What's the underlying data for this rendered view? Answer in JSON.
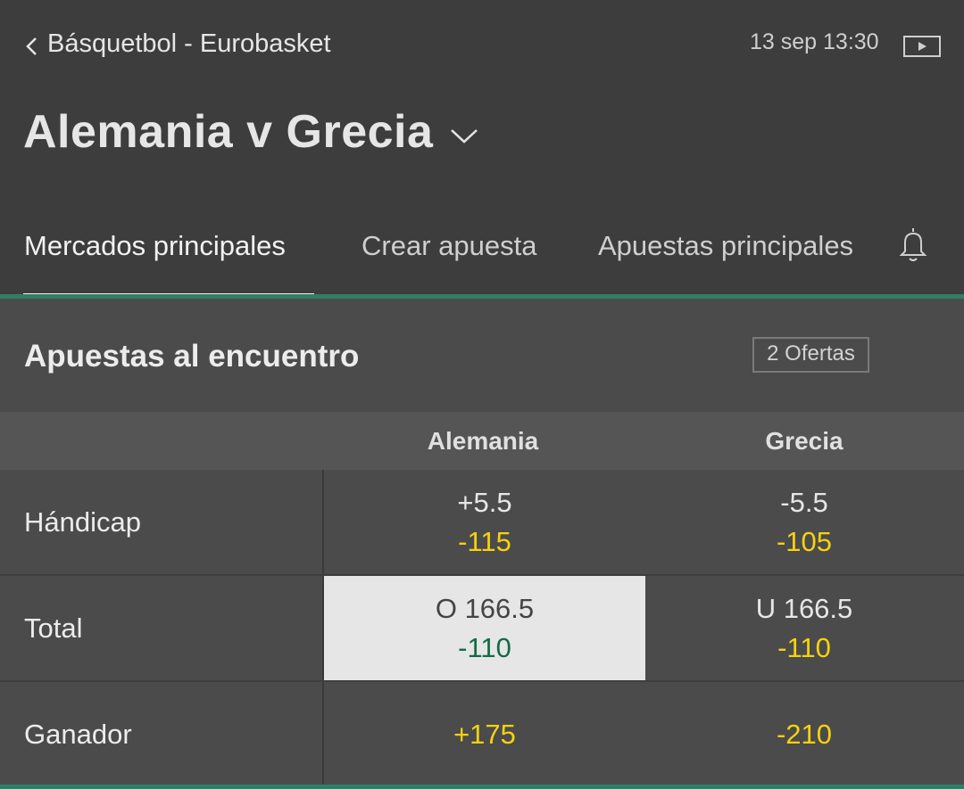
{
  "header": {
    "breadcrumb": "Básquetbol - Eurobasket",
    "datetime": "13 sep 13:30",
    "title": "Alemania v Grecia"
  },
  "tabs": [
    {
      "label": "Mercados principales",
      "active": true
    },
    {
      "label": "Crear apuesta",
      "active": false
    },
    {
      "label": "Apuestas principales",
      "active": false
    }
  ],
  "section": {
    "title": "Apuestas al encuentro",
    "offers": "2 Ofertas"
  },
  "table": {
    "columns": [
      "Alemania",
      "Grecia"
    ],
    "rows": [
      {
        "label": "Hándicap",
        "cells": [
          {
            "line": "+5.5",
            "odds": "-115"
          },
          {
            "line": "-5.5",
            "odds": "-105"
          }
        ]
      },
      {
        "label": "Total",
        "cells": [
          {
            "line": "O 166.5",
            "odds": "-110",
            "selected": true
          },
          {
            "line": "U 166.5",
            "odds": "-110"
          }
        ]
      },
      {
        "label": "Ganador",
        "cells": [
          {
            "line": "",
            "odds": "+175"
          },
          {
            "line": "",
            "odds": "-210"
          }
        ]
      }
    ]
  },
  "colors": {
    "accent": "#2f7f66",
    "odds": "#f5d20f",
    "selected_odds": "#136b43"
  },
  "icons": [
    "back-chevron-icon",
    "play-icon",
    "chevron-down-icon",
    "bell-icon"
  ]
}
